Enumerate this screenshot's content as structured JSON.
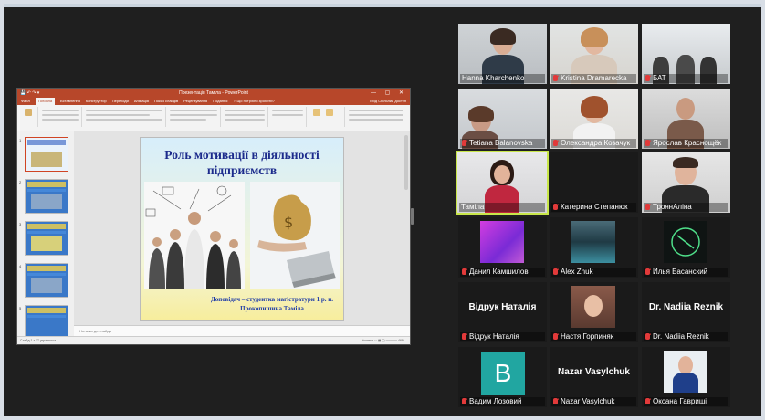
{
  "ppt": {
    "title_bar": "Презентація Таміла - PowerPoint",
    "quick_access": "💾 ↶ ↷ ▾",
    "tabs": [
      "Файл",
      "Головна",
      "Вставлення",
      "Конструктор",
      "Переходи",
      "Анімація",
      "Показ слайдів",
      "Рецензування",
      "Подання"
    ],
    "active_tab_index": 1,
    "tell_me": "♀ Що потрібно зробити?",
    "tabs_right": "Вхід  Спільний доступ",
    "notes_placeholder": "Нотатки до слайда",
    "status_left": "Слайд 1 з 17   українська",
    "status_right": "Нотатки   ▭   ▦   ▢   ─────   46%",
    "thumb_numbers": [
      "1",
      "2",
      "3",
      "4",
      "5"
    ],
    "slide": {
      "title": "Роль мотивації в діяльності підприємств",
      "footer_line1": "Доповідач – студентка магістратури 1 р. н.",
      "footer_line2": "Прокопишина Таміла"
    }
  },
  "participants": [
    {
      "name": "Hanna Kharchenko"
    },
    {
      "name": "Kristina Dramarecka"
    },
    {
      "name": "БАТ"
    },
    {
      "name": "Tetiana Balanovska"
    },
    {
      "name": "Олександра Козачук"
    },
    {
      "name": "Ярослав Краснощёк"
    },
    {
      "name": "Таміла"
    },
    {
      "name": "Катерина Степанюк"
    },
    {
      "name": "ТроянАліна"
    },
    {
      "name": "Данил Камшилов"
    },
    {
      "name": "Alex Zhuk"
    },
    {
      "name": "Илья Басанский"
    },
    {
      "name": "Відрук Наталія",
      "big": "Відрук Наталія"
    },
    {
      "name": "Настя Горпиняк"
    },
    {
      "name": "Dr.  Nadiia Reznik",
      "big": "Dr.  Nadiia Reznik"
    },
    {
      "name": "Вадим Лозовий",
      "avatar": "B"
    },
    {
      "name": "Nazar Vasylchuk",
      "big": "Nazar Vasylchuk"
    },
    {
      "name": "Оксана Гавриші"
    }
  ],
  "colors": {
    "ppt_accent": "#b7472a",
    "active_speaker": "#c8e64a",
    "mic_muted": "#e23a3a",
    "avatar_teal": "#21a6a1"
  }
}
